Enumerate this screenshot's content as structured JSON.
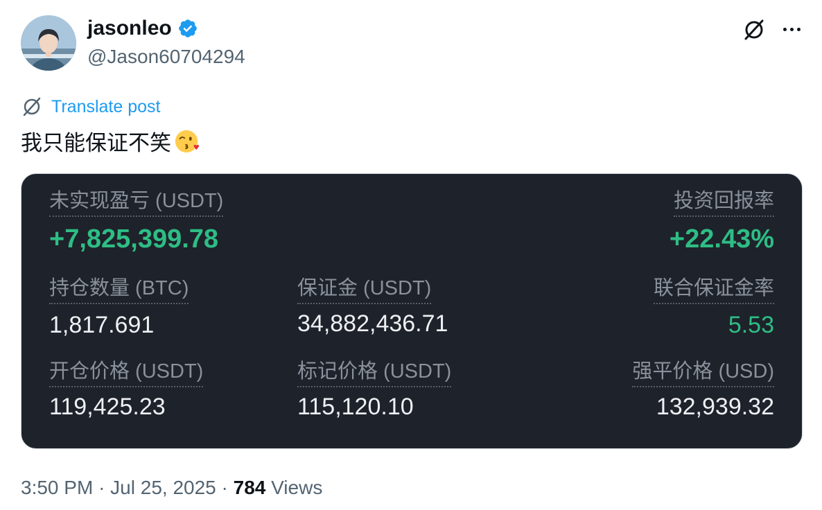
{
  "author": {
    "name": "jasonleo",
    "handle": "@Jason60704294"
  },
  "post": {
    "translate_label": "Translate post",
    "text": "我只能保证不笑"
  },
  "card": {
    "unrealized_pnl_label": "未实现盈亏 (USDT)",
    "unrealized_pnl_value": "+7,825,399.78",
    "roi_label": "投资回报率",
    "roi_value": "+22.43%",
    "position_size_label": "持仓数量 (BTC)",
    "position_size_value": "1,817.691",
    "margin_label": "保证金 (USDT)",
    "margin_value": "34,882,436.71",
    "margin_ratio_label": "联合保证金率",
    "margin_ratio_value": "5.53",
    "entry_price_label": "开仓价格 (USDT)",
    "entry_price_value": "119,425.23",
    "mark_price_label": "标记价格 (USDT)",
    "mark_price_value": "115,120.10",
    "liq_price_label": "强平价格 (USD)",
    "liq_price_value": "132,939.32"
  },
  "footer": {
    "time": "3:50 PM",
    "date": "Jul 25, 2025",
    "sep": "·",
    "views_count": "784",
    "views_label": "Views"
  },
  "colors": {
    "card_bg": "#1e222a",
    "profit_green": "#2ebd85",
    "link_blue": "#1d9bf0",
    "verified_blue": "#1d9bf0"
  },
  "icons": [
    "verified-badge-icon",
    "grok-icon",
    "more-icon",
    "translate-icon",
    "kissing-face-emoji"
  ]
}
